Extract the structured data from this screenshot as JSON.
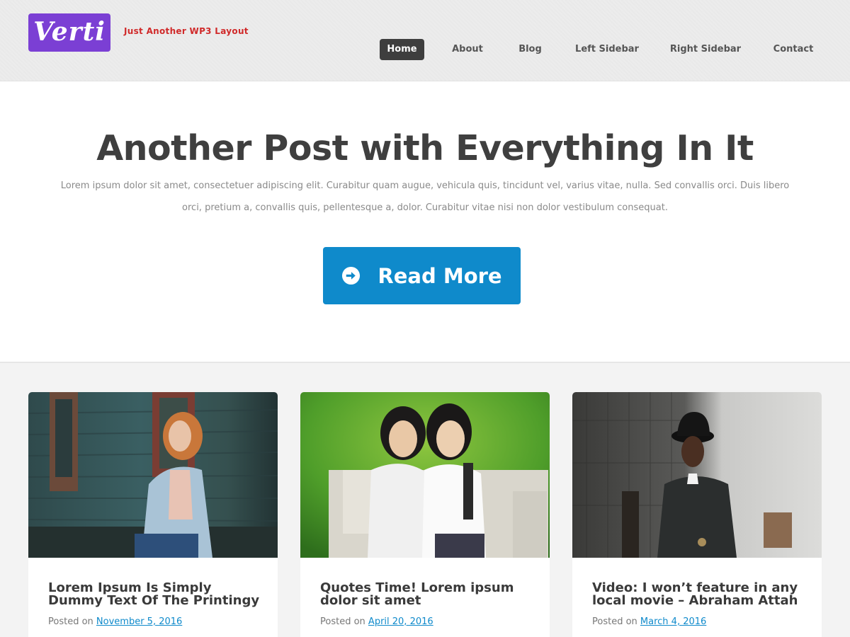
{
  "site": {
    "logo_text": "Verti",
    "tagline": "Just Another WP3 Layout",
    "logo_color": "#7b3fd4",
    "tagline_color": "#d02a2a"
  },
  "nav": {
    "items": [
      {
        "label": "Home",
        "active": true
      },
      {
        "label": "About",
        "active": false
      },
      {
        "label": "Blog",
        "active": false
      },
      {
        "label": "Left Sidebar",
        "active": false
      },
      {
        "label": "Right Sidebar",
        "active": false
      },
      {
        "label": "Contact",
        "active": false
      }
    ]
  },
  "hero": {
    "title": "Another Post with Everything In It",
    "excerpt": "Lorem ipsum dolor sit amet, consectetuer adipiscing elit. Curabitur quam augue, vehicula quis, tincidunt vel, varius vitae, nulla. Sed convallis orci. Duis libero orci, pretium a, convallis quis, pellentesque a, dolor. Curabitur vitae nisi non dolor vestibulum consequat.",
    "button_label": "Read More",
    "button_icon": "arrow-circle-right-icon",
    "button_color": "#0f8acb"
  },
  "posts": [
    {
      "title": "Lorem Ipsum Is Simply Dummy Text Of The Printingy",
      "posted_prefix": "Posted on",
      "date": "November 5, 2016",
      "image": "woman-denim-jacket-photo"
    },
    {
      "title": "Quotes Time! Lorem ipsum dolor sit amet",
      "posted_prefix": "Posted on",
      "date": "April 20, 2016",
      "image": "two-girls-bench-photo"
    },
    {
      "title": "Video: I won’t feature in any local movie – Abraham Attah",
      "posted_prefix": "Posted on",
      "date": "March 4, 2016",
      "image": "man-black-hat-photo"
    }
  ]
}
